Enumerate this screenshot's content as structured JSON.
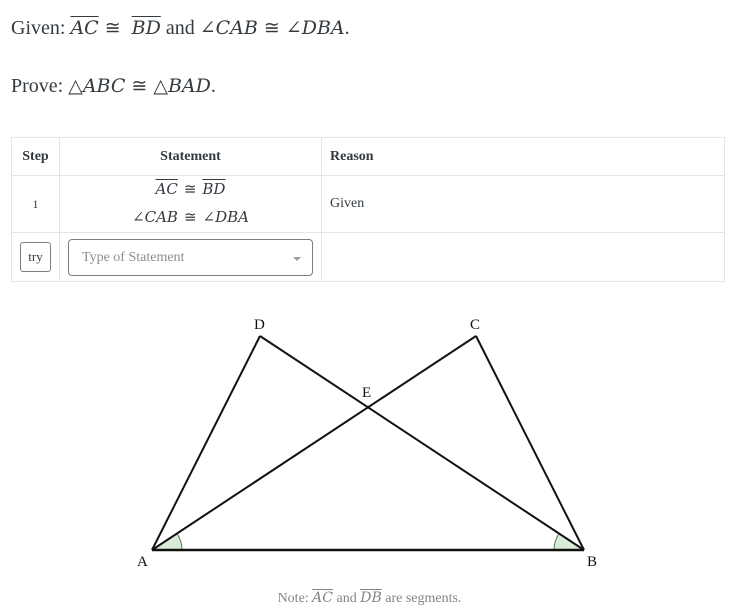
{
  "given": {
    "label": "Given:",
    "seg1": "AC",
    "cong": "≅",
    "seg2": "BD",
    "and": "and",
    "angle1": "∠CAB",
    "angle2": "∠DBA",
    "end": "."
  },
  "prove": {
    "label": "Prove:",
    "tri1": "△ABC",
    "cong": "≅",
    "tri2": "△BAD",
    "end": "."
  },
  "table": {
    "headers": {
      "step": "Step",
      "statement": "Statement",
      "reason": "Reason"
    },
    "rows": [
      {
        "step": "1",
        "statement_line1": {
          "a": "AC",
          "rel": "≅",
          "b": "BD"
        },
        "statement_line2": {
          "a": "∠CAB",
          "rel": "≅",
          "b": "∠DBA"
        },
        "reason": "Given"
      }
    ],
    "input_row": {
      "try_label": "try",
      "statement_placeholder": "Type of Statement"
    }
  },
  "diagram": {
    "points": {
      "A": "A",
      "B": "B",
      "C": "C",
      "D": "D",
      "E": "E"
    },
    "angle_fill": "#d9ecd9",
    "stroke": "#111111"
  },
  "note": {
    "prefix": "Note:",
    "seg1": "AC",
    "and": "and",
    "seg2": "DB",
    "suffix": "are segments."
  }
}
